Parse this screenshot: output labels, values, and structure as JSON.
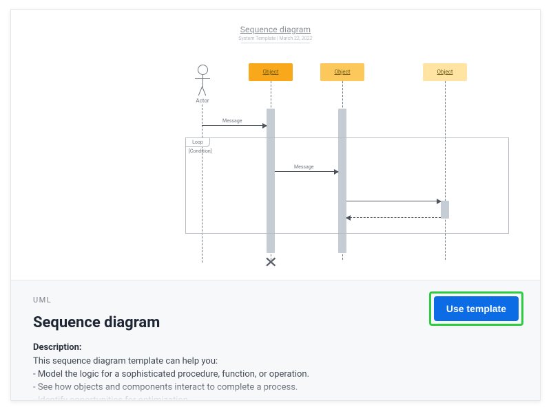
{
  "diagram": {
    "title": "Sequence diagram",
    "subtitle": "System Template | March 22, 2022",
    "actor_label": "Actor",
    "objects": [
      "Object",
      "Object",
      "Object"
    ],
    "fragment": {
      "type": "Loop",
      "guard": "[Condition]"
    },
    "messages": [
      {
        "label": "Message",
        "from": "actor",
        "to": "o1",
        "kind": "sync"
      },
      {
        "label": "Message",
        "from": "o1",
        "to": "o2",
        "kind": "sync"
      },
      {
        "label": "",
        "from": "o2",
        "to": "o3",
        "kind": "sync"
      },
      {
        "label": "",
        "from": "o3",
        "to": "o2",
        "kind": "return"
      }
    ]
  },
  "panel": {
    "category": "UML",
    "title": "Sequence diagram",
    "description_label": "Description:",
    "intro": "This sequence diagram template can help you:",
    "bullets": [
      "Model the logic for a sophisticated procedure, function, or operation.",
      "See how objects and components interact to complete a process.",
      "Identify opportunities for optimization."
    ],
    "button_label": "Use template"
  }
}
